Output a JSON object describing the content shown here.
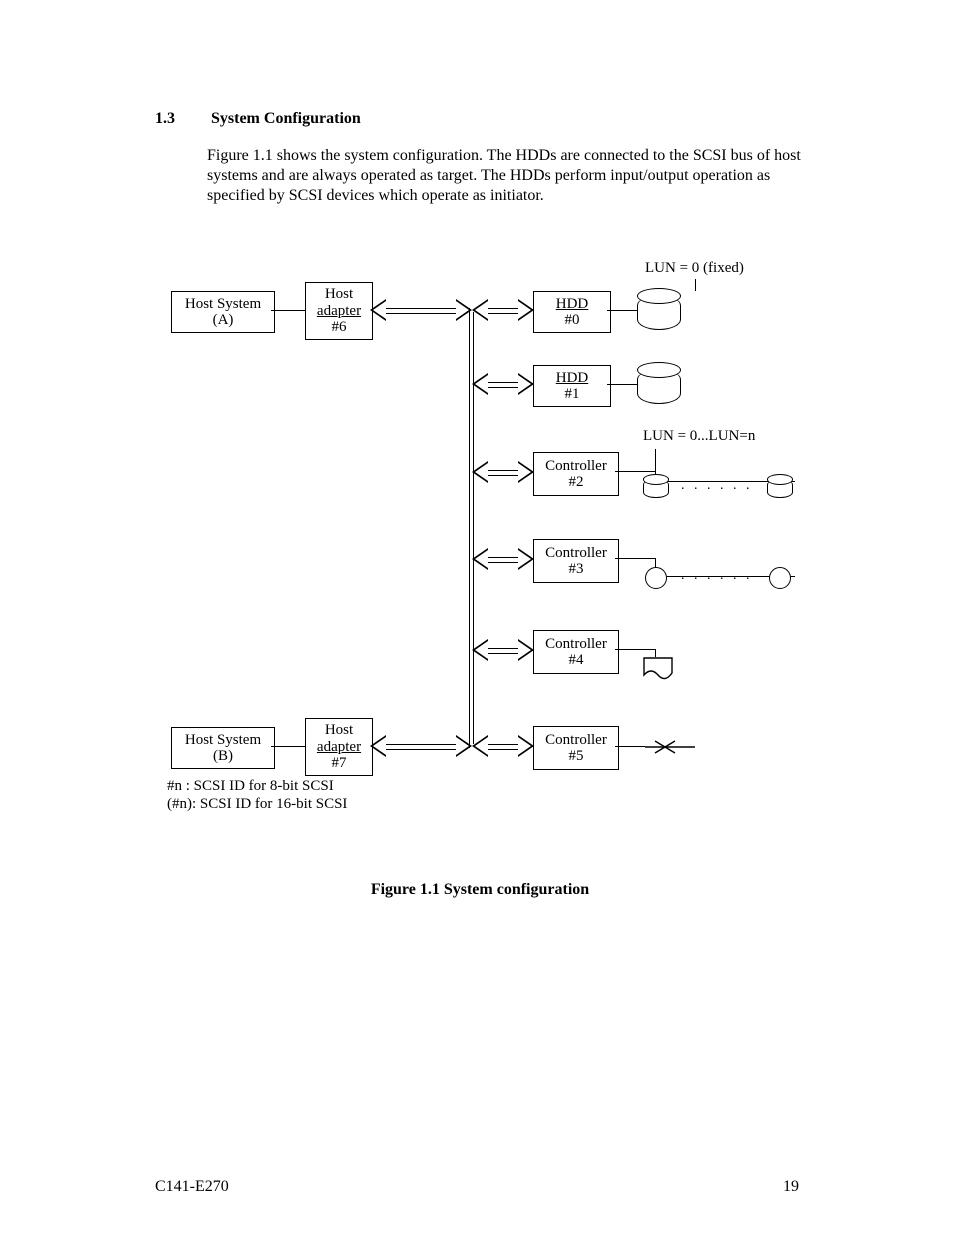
{
  "section": {
    "number": "1.3",
    "title": "System Configuration"
  },
  "intro": "Figure 1.1 shows the system configuration.  The HDDs are connected to the SCSI bus of host systems and are always operated as target.  The HDDs perform input/output operation as specified by SCSI devices which operate as initiator.",
  "figure": {
    "caption": "Figure 1.1    System configuration"
  },
  "footer": {
    "doc_id": "C141-E270",
    "page": "19"
  },
  "diagram": {
    "lun_fixed": "LUN = 0 (fixed)",
    "lun_range": "LUN = 0...LUN=n",
    "host_a": {
      "line1": "Host System",
      "line2": "(A)"
    },
    "host_b": {
      "line1": "Host System",
      "line2": "(B)"
    },
    "adapter_a": {
      "line1": "Host",
      "line2": "adapter",
      "line3": "#6"
    },
    "adapter_b": {
      "line1": "Host",
      "line2": "adapter",
      "line3": "#7"
    },
    "hdd0": {
      "line1": "HDD",
      "line2": "#0"
    },
    "hdd1": {
      "line1": "HDD",
      "line2": "#1"
    },
    "ctrl2": {
      "line1": "Controller",
      "line2": "#2"
    },
    "ctrl3": {
      "line1": "Controller",
      "line2": "#3"
    },
    "ctrl4": {
      "line1": "Controller",
      "line2": "#4"
    },
    "ctrl5": {
      "line1": "Controller",
      "line2": "#5"
    },
    "legend1": "#n :   SCSI ID for 8-bit SCSI",
    "legend2": "(#n): SCSI ID for 16-bit SCSI",
    "dots": ". . . . . ."
  }
}
